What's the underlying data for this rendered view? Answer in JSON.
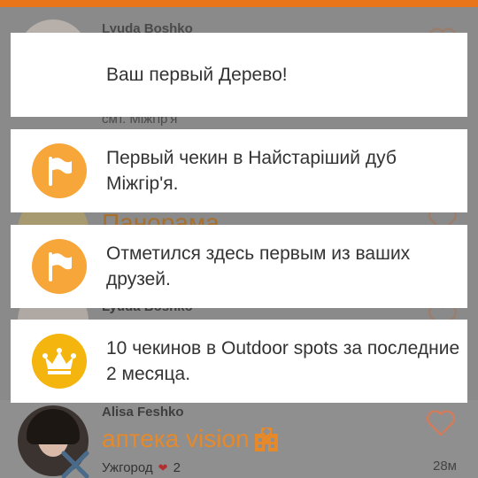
{
  "background_feed": {
    "items": [
      {
        "user": "Lyuda Boshko",
        "subtitle": "смт. Міжгір'я"
      },
      {
        "venue_partial": "Панорама"
      },
      {
        "user": "Lyuda Boshko"
      },
      {
        "user": "Alisa Feshko",
        "venue": "аптека vision",
        "city": "Ужгород",
        "likes": "2",
        "distance": "28м"
      }
    ]
  },
  "notifications": [
    {
      "text": "Ваш первый Дерево!",
      "icon": "none"
    },
    {
      "text": "Первый чекин в Найстаріший дуб Міжгір'я.",
      "icon": "flag-icon"
    },
    {
      "text": "Отметился здесь первым из ваших друзей.",
      "icon": "flag-icon"
    },
    {
      "text": "10 чекинов в Outdoor spots за последние 2 месяца.",
      "icon": "crown-icon"
    }
  ],
  "colors": {
    "accent_orange": "#f29a2e",
    "crown_yellow": "#f5b50f",
    "topbar": "#e8751a",
    "heart_red": "#c0392b"
  }
}
